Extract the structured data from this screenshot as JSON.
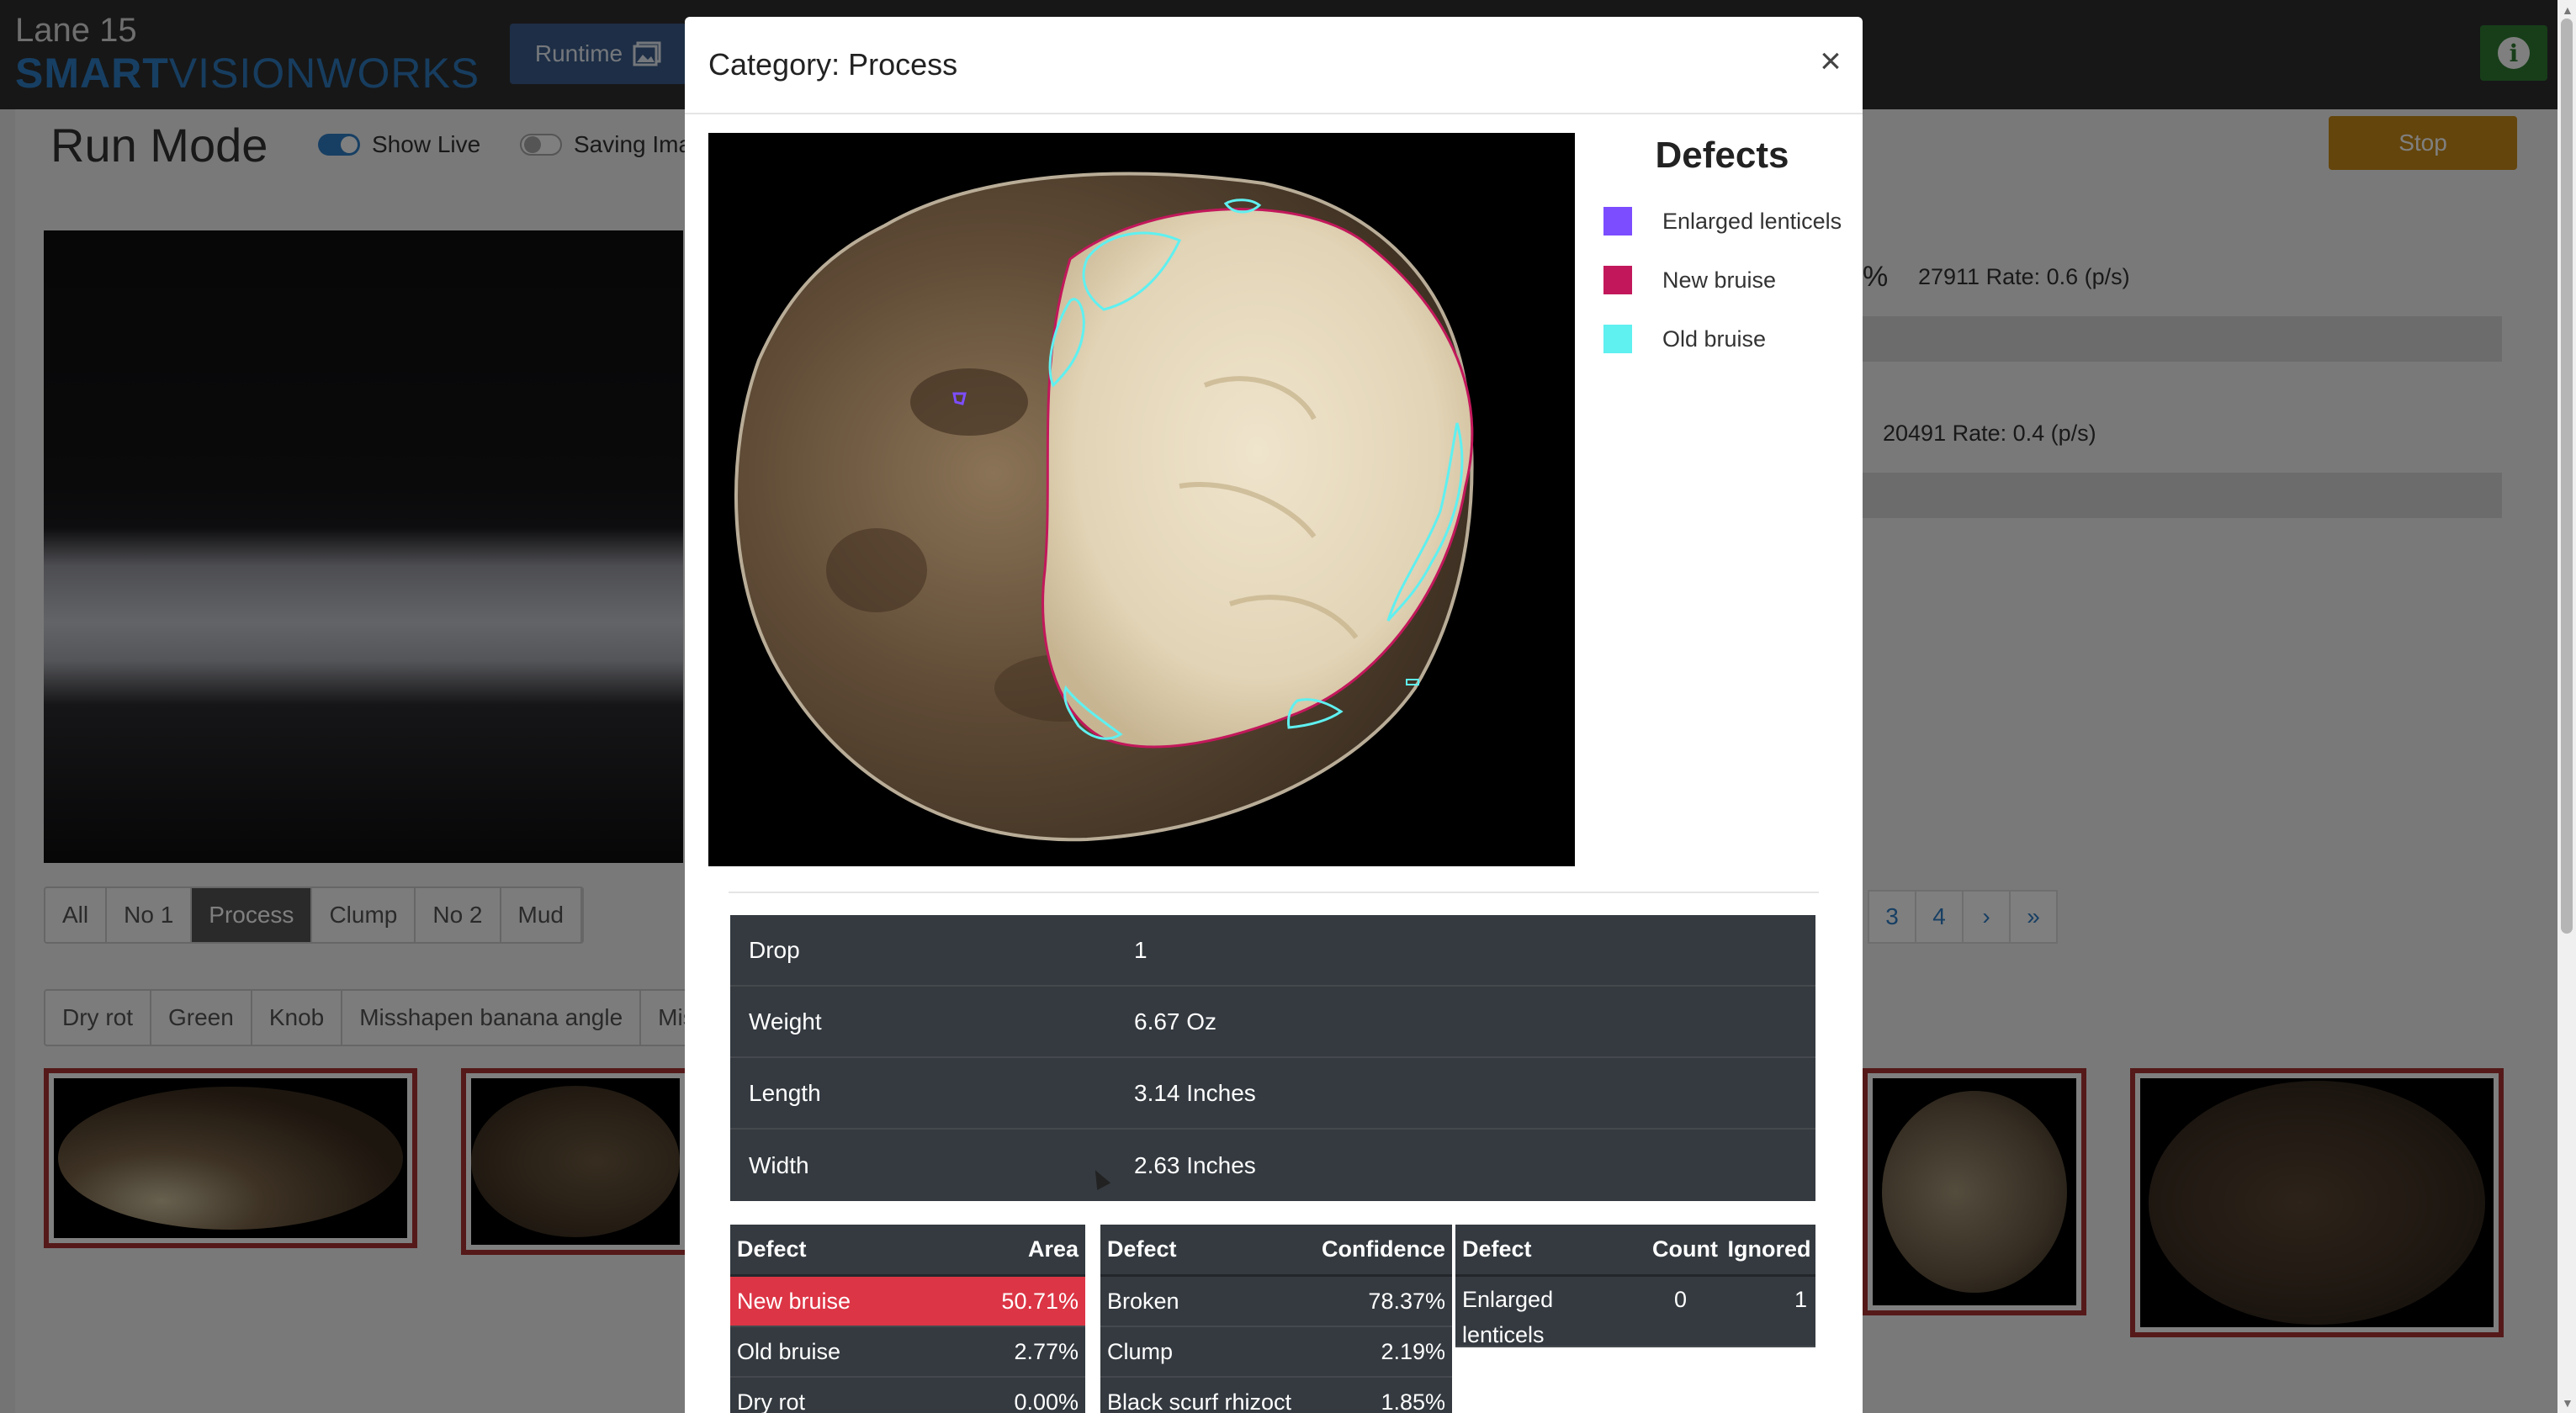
{
  "header": {
    "lane": "Lane 15",
    "logo_smart": "SMART",
    "logo_vision": "VISIONWORKS",
    "runtime_label": "Runtime"
  },
  "run_mode": {
    "title": "Run Mode",
    "show_live_label": "Show Live",
    "show_live_on": true,
    "saving_label": "Saving Ima",
    "saving_on": false,
    "stop_label": "Stop"
  },
  "category_tabs": {
    "items": [
      "All",
      "No 1",
      "Process",
      "Clump",
      "No 2",
      "Mud"
    ],
    "active": "Process"
  },
  "defect_tabs": [
    "Dry rot",
    "Green",
    "Knob",
    "Misshapen banana angle",
    "Mis"
  ],
  "stats": {
    "row1_pct": "%",
    "row1": "27911 Rate: 0.6 (p/s)",
    "row2": "20491 Rate: 0.4 (p/s)"
  },
  "pager": [
    "3",
    "4",
    "›",
    "»"
  ],
  "modal": {
    "title": "Category: Process",
    "close": "×",
    "legend_title": "Defects",
    "legend": [
      {
        "label": "Enlarged lenticels",
        "color": "#7c4dff"
      },
      {
        "label": "New bruise",
        "color": "#c2185b"
      },
      {
        "label": "Old bruise",
        "color": "#5ff0f0"
      }
    ],
    "info": [
      {
        "key": "Drop",
        "value": "1"
      },
      {
        "key": "Weight",
        "value": "6.67 Oz"
      },
      {
        "key": "Length",
        "value": "3.14 Inches"
      },
      {
        "key": "Width",
        "value": "2.63 Inches"
      }
    ],
    "area_table": {
      "headers": [
        "Defect",
        "Area"
      ],
      "rows": [
        {
          "defect": "New bruise",
          "value": "50.71%",
          "highlight": true
        },
        {
          "defect": "Old bruise",
          "value": "2.77%"
        },
        {
          "defect": "Dry rot",
          "value": "0.00%"
        }
      ]
    },
    "confidence_table": {
      "headers": [
        "Defect",
        "Confidence"
      ],
      "rows": [
        {
          "defect": "Broken",
          "value": "78.37%"
        },
        {
          "defect": "Clump",
          "value": "2.19%"
        },
        {
          "defect": "Black scurf rhizoct",
          "value": "1.85%"
        }
      ]
    },
    "count_table": {
      "headers": [
        "Defect",
        "Count",
        "Ignored"
      ],
      "rows": [
        {
          "defect": "Enlarged lenticels",
          "count": "0",
          "ignored": "1"
        }
      ]
    }
  }
}
